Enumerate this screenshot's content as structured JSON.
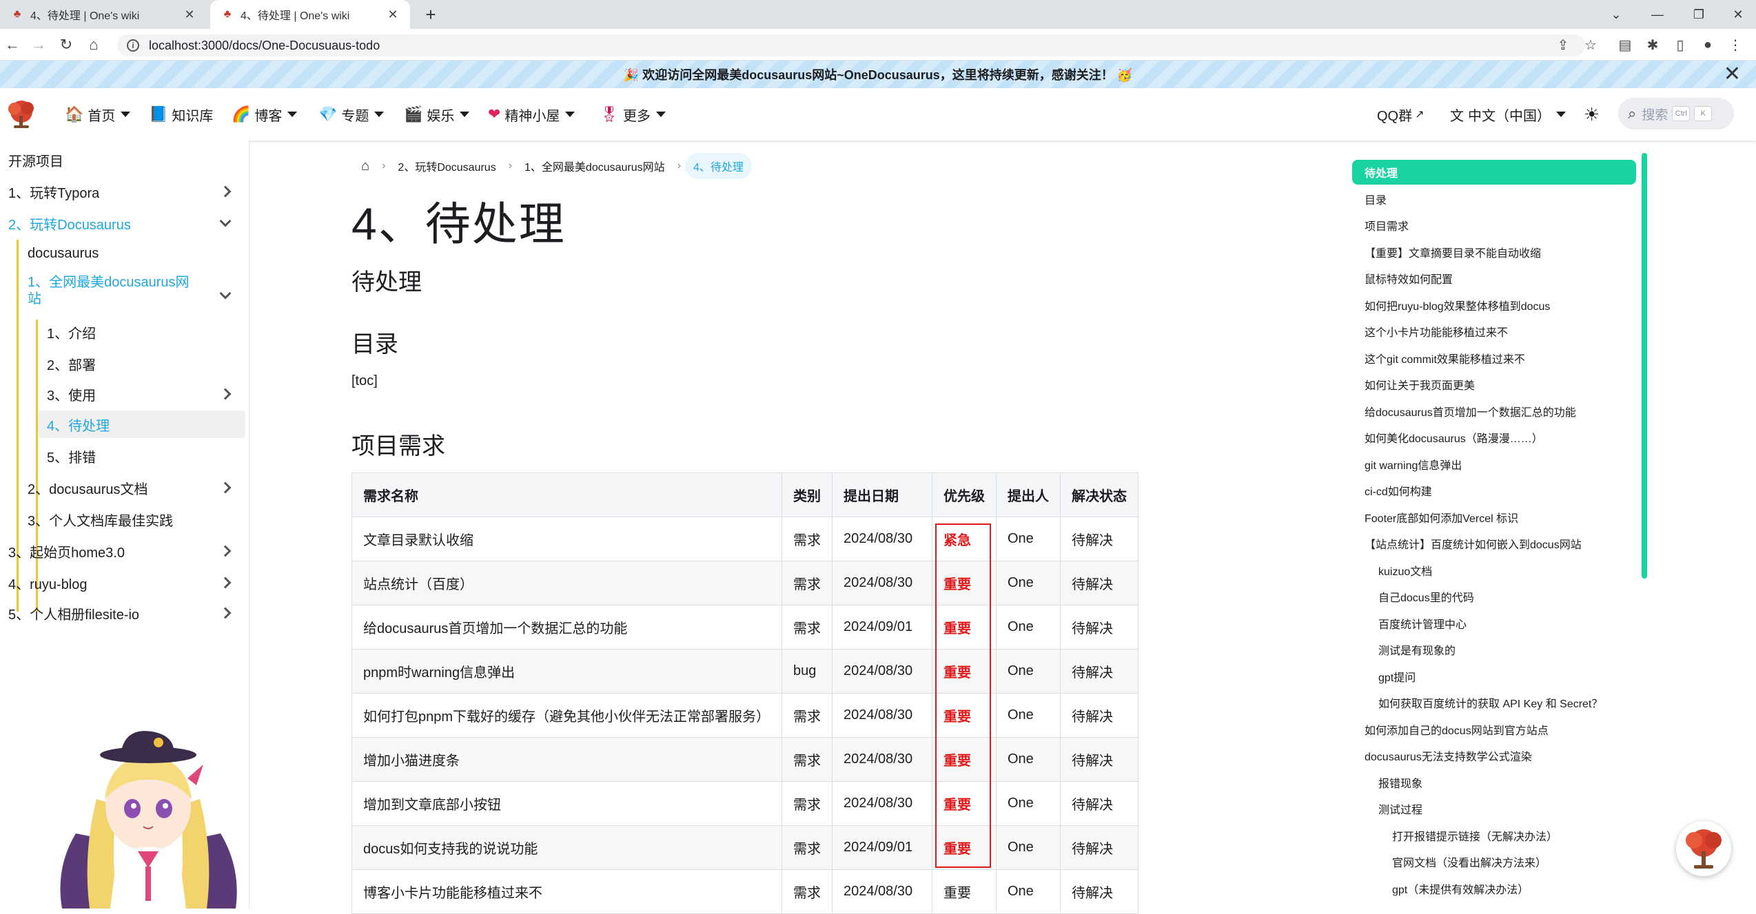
{
  "browser": {
    "tabs": [
      {
        "title": "4、待处理 | One's wiki",
        "active": false
      },
      {
        "title": "4、待处理 | One's wiki",
        "active": true
      }
    ],
    "url": "localhost:3000/docs/One-Docusuaus-todo"
  },
  "announcement": {
    "text": "🎉 欢迎访问全网最美docusaurus网站~OneDocusaurus，这里将持续更新，感谢关注！ 🥳"
  },
  "navbar": {
    "items": [
      {
        "label": "首页",
        "icon": "house-icon",
        "glyph": "🏠",
        "dropdown": true
      },
      {
        "label": "知识库",
        "icon": "book-icon",
        "glyph": "📘",
        "dropdown": false
      },
      {
        "label": "博客",
        "icon": "rainbow-icon",
        "glyph": "🌈",
        "dropdown": true
      },
      {
        "label": "专题",
        "icon": "gem-icon",
        "glyph": "💎",
        "dropdown": true
      },
      {
        "label": "娱乐",
        "icon": "clapper-icon",
        "glyph": "🎬",
        "dropdown": true
      },
      {
        "label": "精神小屋",
        "icon": "heart-icon",
        "glyph": "❤",
        "dropdown": true
      },
      {
        "label": "更多",
        "icon": "medal-icon",
        "glyph": "🎖",
        "dropdown": true
      }
    ],
    "qq_label": "QQ群",
    "lang_label": "中文（中国）",
    "search_placeholder": "搜索",
    "kbd_ctrl": "Ctrl",
    "kbd_k": "K"
  },
  "sidebar": {
    "header": "开源项目",
    "items": [
      {
        "label": "1、玩转Typora",
        "level": 0
      },
      {
        "label": "2、玩转Docusaurus",
        "level": 0
      },
      {
        "label": "docusaurus",
        "level": 1
      },
      {
        "label": "1、全网最美docusaurus网",
        "label2": "站",
        "level": 1
      },
      {
        "label": "1、介绍",
        "level": 2
      },
      {
        "label": "2、部署",
        "level": 2
      },
      {
        "label": "3、使用",
        "level": 2
      },
      {
        "label": "4、待处理",
        "level": 2
      },
      {
        "label": "5、排错",
        "level": 2
      },
      {
        "label": "2、docusaurus文档",
        "level": 1
      },
      {
        "label": "3、个人文档库最佳实践",
        "level": 1
      },
      {
        "label": "3、起始页home3.0",
        "level": 0
      },
      {
        "label": "4、ruyu-blog",
        "level": 0
      },
      {
        "label": "5、个人相册filesite-io",
        "level": 0
      }
    ]
  },
  "breadcrumb": {
    "items": [
      "2、玩转Docusaurus",
      "1、全网最美docusaurus网站",
      "4、待处理"
    ]
  },
  "doc": {
    "title": "4、待处理",
    "subtitle": "待处理",
    "h_toc": "目录",
    "toc_placeholder": "[toc]",
    "h_req": "项目需求"
  },
  "table": {
    "headers": [
      "需求名称",
      "类别",
      "提出日期",
      "优先级",
      "提出人",
      "解决状态"
    ],
    "rows": [
      {
        "name": "文章目录默认收缩",
        "type": "需求",
        "date": "2024/08/30",
        "priority": "紧急",
        "by": "One",
        "status": "待解决",
        "red": true
      },
      {
        "name": "站点统计（百度）",
        "type": "需求",
        "date": "2024/08/30",
        "priority": "重要",
        "by": "One",
        "status": "待解决",
        "red": true
      },
      {
        "name": "给docusaurus首页增加一个数据汇总的功能",
        "type": "需求",
        "date": "2024/09/01",
        "priority": "重要",
        "by": "One",
        "status": "待解决",
        "red": true
      },
      {
        "name": "pnpm时warning信息弹出",
        "type": "bug",
        "date": "2024/08/30",
        "priority": "重要",
        "by": "One",
        "status": "待解决",
        "red": true
      },
      {
        "name": "如何打包pnpm下载好的缓存（避免其他小伙伴无法正常部署服务）",
        "type": "需求",
        "date": "2024/08/30",
        "priority": "重要",
        "by": "One",
        "status": "待解决",
        "red": true
      },
      {
        "name": "增加小猫进度条",
        "type": "需求",
        "date": "2024/08/30",
        "priority": "重要",
        "by": "One",
        "status": "待解决",
        "red": true
      },
      {
        "name": "增加到文章底部小按钮",
        "type": "需求",
        "date": "2024/08/30",
        "priority": "重要",
        "by": "One",
        "status": "待解决",
        "red": true
      },
      {
        "name": "docus如何支持我的说说功能",
        "type": "需求",
        "date": "2024/09/01",
        "priority": "重要",
        "by": "One",
        "status": "待解决",
        "red": true
      },
      {
        "name": "博客小卡片功能能移植过来不",
        "type": "需求",
        "date": "2024/08/30",
        "priority": "重要",
        "by": "One",
        "status": "待解决",
        "red": false
      }
    ]
  },
  "toc": {
    "items": [
      {
        "label": "待处理",
        "level": 0,
        "active": true
      },
      {
        "label": "目录",
        "level": 0
      },
      {
        "label": "项目需求",
        "level": 0
      },
      {
        "label": "【重要】文章摘要目录不能自动收缩",
        "level": 0
      },
      {
        "label": "鼠标特效如何配置",
        "level": 0
      },
      {
        "label": "如何把ruyu-blog效果整体移植到docus",
        "level": 0
      },
      {
        "label": "这个小卡片功能能移植过来不",
        "level": 0
      },
      {
        "label": "这个git commit效果能移植过来不",
        "level": 0
      },
      {
        "label": "如何让关于我页面更美",
        "level": 0
      },
      {
        "label": "给docusaurus首页增加一个数据汇总的功能",
        "level": 0
      },
      {
        "label": "如何美化docusaurus（路漫漫……）",
        "level": 0
      },
      {
        "label": "git warning信息弹出",
        "level": 0
      },
      {
        "label": "ci-cd如何构建",
        "level": 0
      },
      {
        "label": "Footer底部如何添加Vercel 标识",
        "level": 0
      },
      {
        "label": "【站点统计】百度统计如何嵌入到docus网站",
        "level": 0
      },
      {
        "label": "kuizuo文档",
        "level": 1
      },
      {
        "label": "自己docus里的代码",
        "level": 1
      },
      {
        "label": "百度统计管理中心",
        "level": 1
      },
      {
        "label": "测试是有现象的",
        "level": 1
      },
      {
        "label": "gpt提问",
        "level": 1
      },
      {
        "label": "如何获取百度统计的获取 API Key 和 Secret？",
        "level": 1
      },
      {
        "label": "如何添加自己的docus网站到官方站点",
        "level": 0
      },
      {
        "label": "docusaurus无法支持数学公式渲染",
        "level": 0
      },
      {
        "label": "报错现象",
        "level": 1
      },
      {
        "label": "测试过程",
        "level": 1
      },
      {
        "label": "打开报错提示链接（无解决办法）",
        "level": 2
      },
      {
        "label": "官网文档（没看出解决方法来）",
        "level": 2
      },
      {
        "label": "gpt（未提供有效解决办法）",
        "level": 2
      }
    ]
  },
  "colors": {
    "accent": "#1fa8e0",
    "toc_active": "#19d3a2",
    "priority_red": "#e01b1b"
  }
}
